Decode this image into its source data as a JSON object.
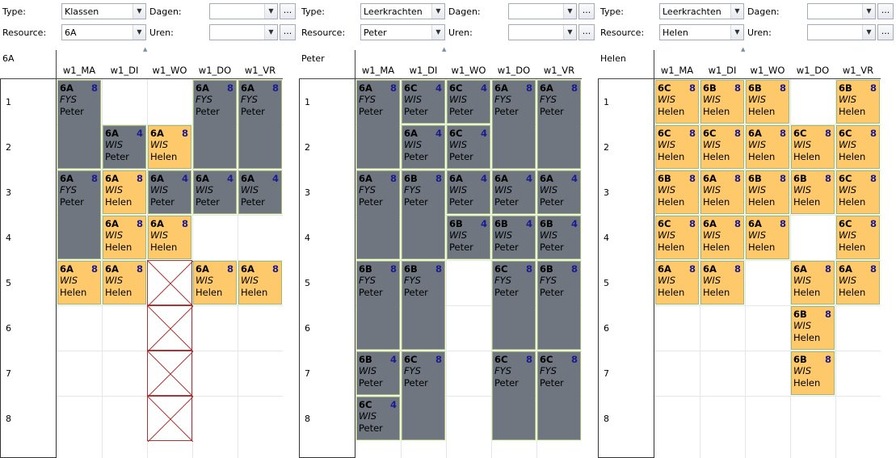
{
  "labels": {
    "type": "Type:",
    "resource": "Resource:",
    "dagen": "Dagen:",
    "uren": "Uren:",
    "ellipsis": "...",
    "arrow": "▼",
    "splitter": "▲"
  },
  "days": [
    "w1_MA",
    "w1_DI",
    "w1_WO",
    "w1_DO",
    "w1_VR"
  ],
  "rows": [
    "1",
    "2",
    "3",
    "4",
    "5",
    "6",
    "7",
    "8"
  ],
  "panels": [
    {
      "type_value": "Klassen",
      "resource_value": "6A",
      "resource_name": "6A",
      "cards": [
        {
          "day": 0,
          "start": 0,
          "span": 2,
          "color": "gray",
          "class": "6A",
          "count": "8",
          "subject": "FYS",
          "teacher": "Peter"
        },
        {
          "day": 3,
          "start": 0,
          "span": 2,
          "color": "gray",
          "class": "6A",
          "count": "8",
          "subject": "FYS",
          "teacher": "Peter"
        },
        {
          "day": 4,
          "start": 0,
          "span": 2,
          "color": "gray",
          "class": "6A",
          "count": "8",
          "subject": "FYS",
          "teacher": "Peter"
        },
        {
          "day": 1,
          "start": 1,
          "span": 1,
          "color": "gray",
          "class": "6A",
          "count": "4",
          "subject": "WIS",
          "teacher": "Peter"
        },
        {
          "day": 2,
          "start": 1,
          "span": 1,
          "color": "orange",
          "class": "6A",
          "count": "8",
          "subject": "WIS",
          "teacher": "Helen"
        },
        {
          "day": 0,
          "start": 2,
          "span": 2,
          "color": "gray",
          "class": "6A",
          "count": "8",
          "subject": "FYS",
          "teacher": "Peter"
        },
        {
          "day": 1,
          "start": 2,
          "span": 1,
          "color": "orange",
          "class": "6A",
          "count": "8",
          "subject": "WIS",
          "teacher": "Helen"
        },
        {
          "day": 2,
          "start": 2,
          "span": 1,
          "color": "gray",
          "class": "6A",
          "count": "4",
          "subject": "WIS",
          "teacher": "Peter"
        },
        {
          "day": 3,
          "start": 2,
          "span": 1,
          "color": "gray",
          "class": "6A",
          "count": "4",
          "subject": "WIS",
          "teacher": "Peter"
        },
        {
          "day": 4,
          "start": 2,
          "span": 1,
          "color": "gray",
          "class": "6A",
          "count": "4",
          "subject": "WIS",
          "teacher": "Peter"
        },
        {
          "day": 1,
          "start": 3,
          "span": 1,
          "color": "orange",
          "class": "6A",
          "count": "8",
          "subject": "WIS",
          "teacher": "Helen"
        },
        {
          "day": 2,
          "start": 3,
          "span": 1,
          "color": "orange",
          "class": "6A",
          "count": "8",
          "subject": "WIS",
          "teacher": "Helen"
        },
        {
          "day": 0,
          "start": 4,
          "span": 1,
          "color": "orange",
          "class": "6A",
          "count": "8",
          "subject": "WIS",
          "teacher": "Helen"
        },
        {
          "day": 1,
          "start": 4,
          "span": 1,
          "color": "orange",
          "class": "6A",
          "count": "8",
          "subject": "WIS",
          "teacher": "Helen"
        },
        {
          "day": 3,
          "start": 4,
          "span": 1,
          "color": "orange",
          "class": "6A",
          "count": "8",
          "subject": "WIS",
          "teacher": "Helen"
        },
        {
          "day": 4,
          "start": 4,
          "span": 1,
          "color": "orange",
          "class": "6A",
          "count": "8",
          "subject": "WIS",
          "teacher": "Helen"
        }
      ],
      "blocked": [
        {
          "day": 2,
          "row": 4
        },
        {
          "day": 2,
          "row": 5
        },
        {
          "day": 2,
          "row": 6
        },
        {
          "day": 2,
          "row": 7
        }
      ]
    },
    {
      "type_value": "Leerkrachten",
      "resource_value": "Peter",
      "resource_name": "Peter",
      "cards": [
        {
          "day": 0,
          "start": 0,
          "span": 2,
          "color": "gray",
          "class": "6A",
          "count": "8",
          "subject": "FYS",
          "teacher": "Peter"
        },
        {
          "day": 1,
          "start": 0,
          "span": 1,
          "color": "gray",
          "class": "6C",
          "count": "4",
          "subject": "WIS",
          "teacher": "Peter"
        },
        {
          "day": 2,
          "start": 0,
          "span": 1,
          "color": "gray",
          "class": "6C",
          "count": "4",
          "subject": "WIS",
          "teacher": "Peter"
        },
        {
          "day": 3,
          "start": 0,
          "span": 2,
          "color": "gray",
          "class": "6A",
          "count": "8",
          "subject": "FYS",
          "teacher": "Peter"
        },
        {
          "day": 4,
          "start": 0,
          "span": 2,
          "color": "gray",
          "class": "6A",
          "count": "8",
          "subject": "FYS",
          "teacher": "Peter"
        },
        {
          "day": 1,
          "start": 1,
          "span": 1,
          "color": "gray",
          "class": "6A",
          "count": "4",
          "subject": "WIS",
          "teacher": "Peter"
        },
        {
          "day": 2,
          "start": 1,
          "span": 1,
          "color": "gray",
          "class": "6C",
          "count": "4",
          "subject": "WIS",
          "teacher": "Peter"
        },
        {
          "day": 0,
          "start": 2,
          "span": 2,
          "color": "gray",
          "class": "6A",
          "count": "8",
          "subject": "FYS",
          "teacher": "Peter"
        },
        {
          "day": 1,
          "start": 2,
          "span": 2,
          "color": "gray",
          "class": "6B",
          "count": "8",
          "subject": "FYS",
          "teacher": "Peter"
        },
        {
          "day": 2,
          "start": 2,
          "span": 1,
          "color": "gray",
          "class": "6A",
          "count": "4",
          "subject": "WIS",
          "teacher": "Peter"
        },
        {
          "day": 3,
          "start": 2,
          "span": 1,
          "color": "gray",
          "class": "6A",
          "count": "4",
          "subject": "WIS",
          "teacher": "Peter"
        },
        {
          "day": 4,
          "start": 2,
          "span": 1,
          "color": "gray",
          "class": "6A",
          "count": "4",
          "subject": "WIS",
          "teacher": "Peter"
        },
        {
          "day": 2,
          "start": 3,
          "span": 1,
          "color": "gray",
          "class": "6B",
          "count": "4",
          "subject": "WIS",
          "teacher": "Peter"
        },
        {
          "day": 3,
          "start": 3,
          "span": 1,
          "color": "gray",
          "class": "6B",
          "count": "4",
          "subject": "WIS",
          "teacher": "Peter"
        },
        {
          "day": 4,
          "start": 3,
          "span": 1,
          "color": "gray",
          "class": "6B",
          "count": "4",
          "subject": "WIS",
          "teacher": "Peter"
        },
        {
          "day": 0,
          "start": 4,
          "span": 2,
          "color": "gray",
          "class": "6B",
          "count": "8",
          "subject": "FYS",
          "teacher": "Peter"
        },
        {
          "day": 1,
          "start": 4,
          "span": 2,
          "color": "gray",
          "class": "6B",
          "count": "8",
          "subject": "FYS",
          "teacher": "Peter"
        },
        {
          "day": 3,
          "start": 4,
          "span": 2,
          "color": "gray",
          "class": "6C",
          "count": "8",
          "subject": "FYS",
          "teacher": "Peter"
        },
        {
          "day": 4,
          "start": 4,
          "span": 2,
          "color": "gray",
          "class": "6B",
          "count": "8",
          "subject": "FYS",
          "teacher": "Peter"
        },
        {
          "day": 0,
          "start": 6,
          "span": 1,
          "color": "gray",
          "class": "6B",
          "count": "4",
          "subject": "WIS",
          "teacher": "Peter"
        },
        {
          "day": 1,
          "start": 6,
          "span": 2,
          "color": "gray",
          "class": "6C",
          "count": "8",
          "subject": "FYS",
          "teacher": "Peter"
        },
        {
          "day": 3,
          "start": 6,
          "span": 2,
          "color": "gray",
          "class": "6C",
          "count": "8",
          "subject": "FYS",
          "teacher": "Peter"
        },
        {
          "day": 4,
          "start": 6,
          "span": 2,
          "color": "gray",
          "class": "6C",
          "count": "8",
          "subject": "FYS",
          "teacher": "Peter"
        },
        {
          "day": 0,
          "start": 7,
          "span": 1,
          "color": "gray",
          "class": "6C",
          "count": "4",
          "subject": "WIS",
          "teacher": "Peter"
        }
      ],
      "blocked": []
    },
    {
      "type_value": "Leerkrachten",
      "resource_value": "Helen",
      "resource_name": "Helen",
      "cards": [
        {
          "day": 0,
          "start": 0,
          "span": 1,
          "color": "orange",
          "class": "6C",
          "count": "8",
          "subject": "WIS",
          "teacher": "Helen"
        },
        {
          "day": 1,
          "start": 0,
          "span": 1,
          "color": "orange",
          "class": "6B",
          "count": "8",
          "subject": "WIS",
          "teacher": "Helen"
        },
        {
          "day": 2,
          "start": 0,
          "span": 1,
          "color": "orange",
          "class": "6B",
          "count": "8",
          "subject": "WIS",
          "teacher": "Helen"
        },
        {
          "day": 4,
          "start": 0,
          "span": 1,
          "color": "orange",
          "class": "6B",
          "count": "8",
          "subject": "WIS",
          "teacher": "Helen"
        },
        {
          "day": 0,
          "start": 1,
          "span": 1,
          "color": "orange",
          "class": "6C",
          "count": "8",
          "subject": "WIS",
          "teacher": "Helen"
        },
        {
          "day": 1,
          "start": 1,
          "span": 1,
          "color": "orange",
          "class": "6C",
          "count": "8",
          "subject": "WIS",
          "teacher": "Helen"
        },
        {
          "day": 2,
          "start": 1,
          "span": 1,
          "color": "orange",
          "class": "6A",
          "count": "8",
          "subject": "WIS",
          "teacher": "Helen"
        },
        {
          "day": 3,
          "start": 1,
          "span": 1,
          "color": "orange",
          "class": "6C",
          "count": "8",
          "subject": "WIS",
          "teacher": "Helen"
        },
        {
          "day": 4,
          "start": 1,
          "span": 1,
          "color": "orange",
          "class": "6C",
          "count": "8",
          "subject": "WIS",
          "teacher": "Helen"
        },
        {
          "day": 0,
          "start": 2,
          "span": 1,
          "color": "orange",
          "class": "6B",
          "count": "8",
          "subject": "WIS",
          "teacher": "Helen"
        },
        {
          "day": 1,
          "start": 2,
          "span": 1,
          "color": "orange",
          "class": "6A",
          "count": "8",
          "subject": "WIS",
          "teacher": "Helen"
        },
        {
          "day": 2,
          "start": 2,
          "span": 1,
          "color": "orange",
          "class": "6B",
          "count": "8",
          "subject": "WIS",
          "teacher": "Helen"
        },
        {
          "day": 3,
          "start": 2,
          "span": 1,
          "color": "orange",
          "class": "6B",
          "count": "8",
          "subject": "WIS",
          "teacher": "Helen"
        },
        {
          "day": 4,
          "start": 2,
          "span": 1,
          "color": "orange",
          "class": "6C",
          "count": "8",
          "subject": "WIS",
          "teacher": "Helen"
        },
        {
          "day": 0,
          "start": 3,
          "span": 1,
          "color": "orange",
          "class": "6C",
          "count": "8",
          "subject": "WIS",
          "teacher": "Helen"
        },
        {
          "day": 1,
          "start": 3,
          "span": 1,
          "color": "orange",
          "class": "6A",
          "count": "8",
          "subject": "WIS",
          "teacher": "Helen"
        },
        {
          "day": 2,
          "start": 3,
          "span": 1,
          "color": "orange",
          "class": "6A",
          "count": "8",
          "subject": "WIS",
          "teacher": "Helen"
        },
        {
          "day": 4,
          "start": 3,
          "span": 1,
          "color": "orange",
          "class": "6C",
          "count": "8",
          "subject": "WIS",
          "teacher": "Helen"
        },
        {
          "day": 0,
          "start": 4,
          "span": 1,
          "color": "orange",
          "class": "6A",
          "count": "8",
          "subject": "WIS",
          "teacher": "Helen"
        },
        {
          "day": 1,
          "start": 4,
          "span": 1,
          "color": "orange",
          "class": "6A",
          "count": "8",
          "subject": "WIS",
          "teacher": "Helen"
        },
        {
          "day": 3,
          "start": 4,
          "span": 1,
          "color": "orange",
          "class": "6A",
          "count": "8",
          "subject": "WIS",
          "teacher": "Helen"
        },
        {
          "day": 4,
          "start": 4,
          "span": 1,
          "color": "orange",
          "class": "6A",
          "count": "8",
          "subject": "WIS",
          "teacher": "Helen"
        },
        {
          "day": 3,
          "start": 5,
          "span": 1,
          "color": "orange",
          "class": "6B",
          "count": "8",
          "subject": "WIS",
          "teacher": "Helen"
        },
        {
          "day": 3,
          "start": 6,
          "span": 1,
          "color": "orange",
          "class": "6B",
          "count": "8",
          "subject": "WIS",
          "teacher": "Helen"
        }
      ],
      "blocked": []
    }
  ],
  "colors": {
    "gray_card": "#6f7680",
    "orange_card": "#fdc96a",
    "card_border": "#9dbb6b",
    "count_text": "#1b1b8f",
    "blocked_border": "#a33"
  },
  "icons": {
    "combo_arrow": "chevron-down-icon",
    "ellipsis": "ellipsis-button",
    "blocked": "cross-icon"
  }
}
